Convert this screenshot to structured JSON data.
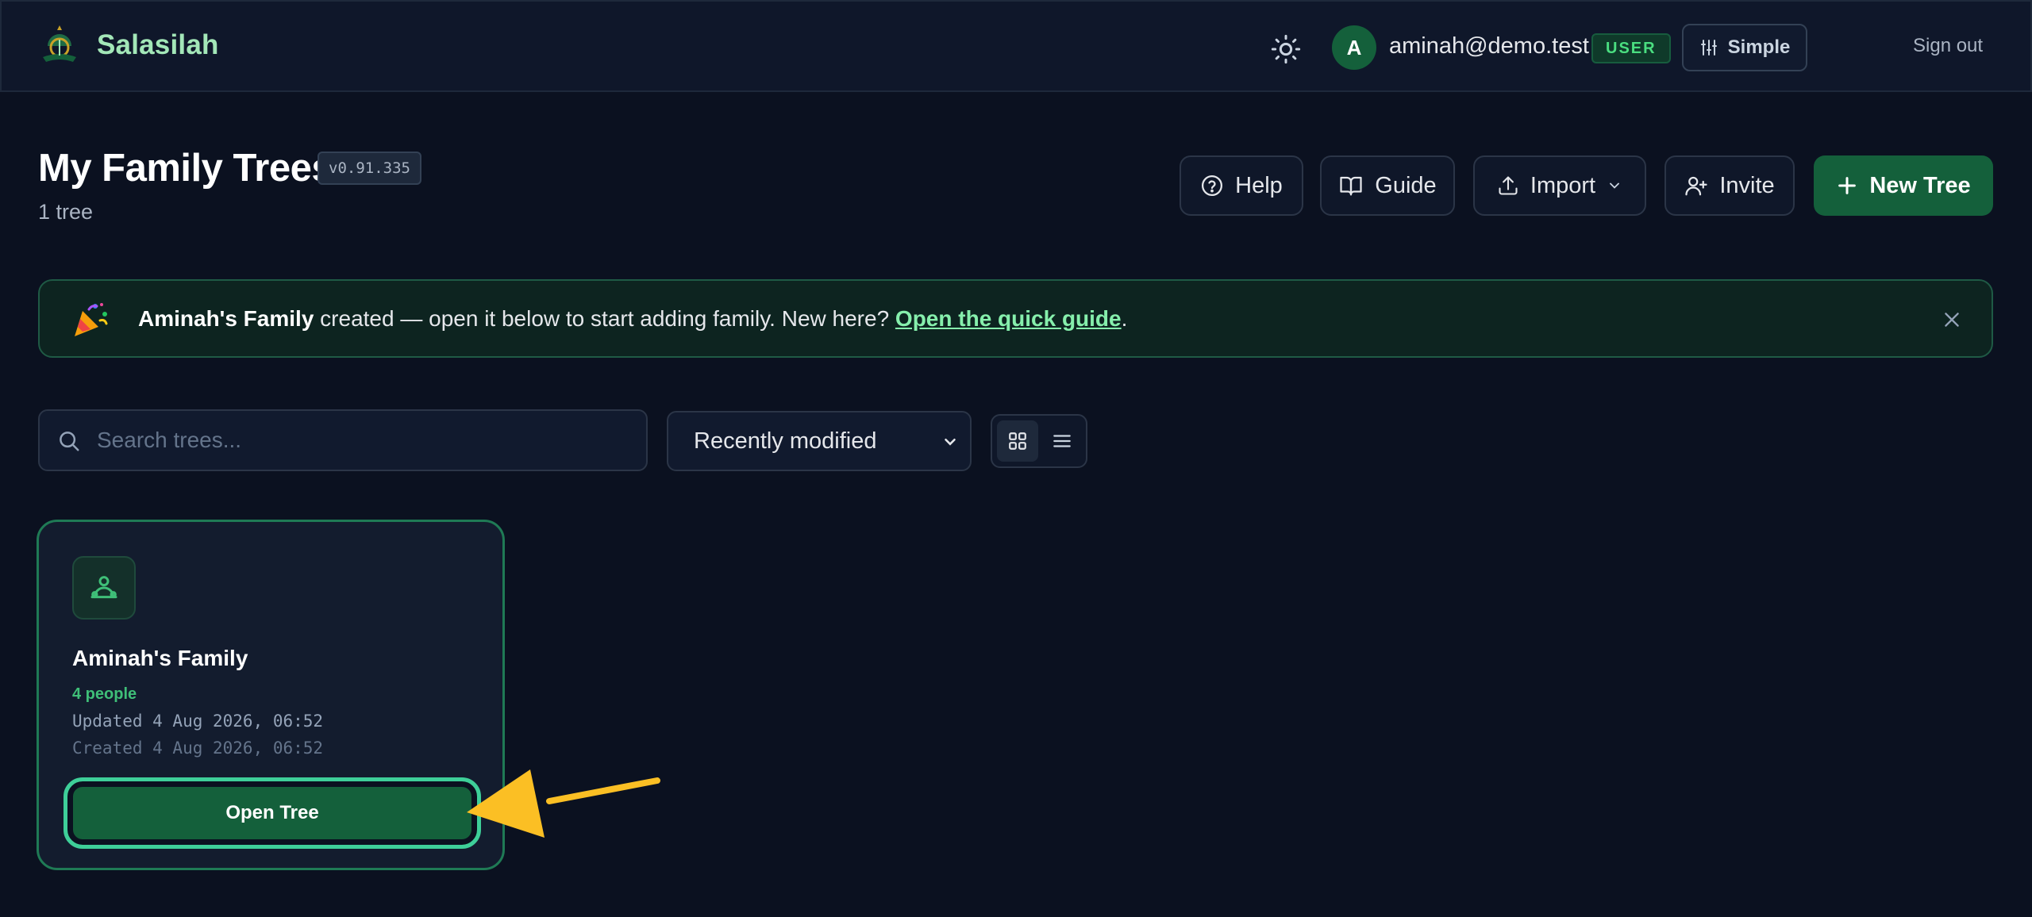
{
  "header": {
    "brand_name": "Salasilah",
    "user_initial": "A",
    "user_email": "aminah@demo.test",
    "role_badge": "USER",
    "mode_label": "Simple",
    "signout_label": "Sign out"
  },
  "page": {
    "title": "My Family Trees",
    "version": "v0.91.335",
    "tree_count": "1 tree"
  },
  "actions": {
    "help": "Help",
    "guide": "Guide",
    "import": "Import",
    "invite": "Invite",
    "new_tree": "New Tree"
  },
  "banner": {
    "tree_name": "Aminah's Family",
    "message": " created — open it below to start adding family. New here? ",
    "link": "Open the quick guide",
    "suffix": "."
  },
  "toolbar": {
    "search_placeholder": "Search trees...",
    "search_value": "",
    "sort_selected": "Recently modified",
    "view_mode": "grid"
  },
  "trees": [
    {
      "name": "Aminah's Family",
      "people": "4 people",
      "updated": "Updated 4 Aug 2026, 06:52",
      "created": "Created 4 Aug 2026, 06:52",
      "open_label": "Open Tree"
    }
  ],
  "colors": {
    "background": "#0b1120",
    "brand": "#a3e7b8",
    "accent": "#14603b",
    "highlight": "#3ecf99",
    "annotation_arrow": "#fbbf24"
  },
  "icons": {
    "brand": "mosque-tree-logo",
    "theme": "sun-icon",
    "mode": "sliders-icon",
    "help": "help-circle-icon",
    "guide": "book-open-icon",
    "import": "upload-icon",
    "invite": "user-plus-icon",
    "new_tree": "plus-icon",
    "banner": "party-popper-icon",
    "close": "close-icon",
    "search": "search-icon",
    "grid": "grid-icon",
    "list": "list-icon",
    "tree_card": "family-icon"
  }
}
